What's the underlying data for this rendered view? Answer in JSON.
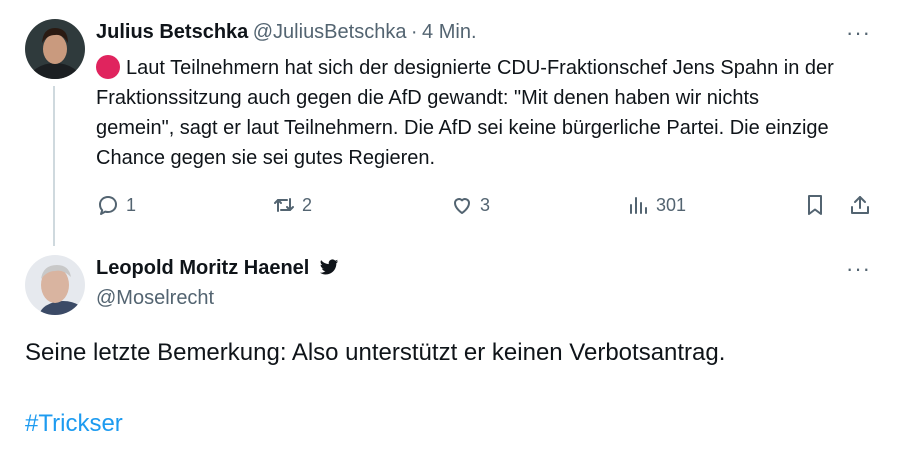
{
  "tweet1": {
    "name": "Julius Betschka",
    "handle": "@JuliusBetschka",
    "separator": "·",
    "time": "4 Min.",
    "text": "Laut Teilnehmern hat sich der designierte CDU-Fraktionschef Jens Spahn in der Fraktionssitzung auch gegen die AfD gewandt: \"Mit denen haben wir nichts gemein\", sagt er laut Teilnehmern. Die AfD sei keine bürgerliche Partei. Die einzige Chance gegen sie sei gutes Regieren.",
    "indicator_icon": "red-circle-emoji",
    "more_label": "···",
    "actions": {
      "reply_count": "1",
      "retweet_count": "2",
      "like_count": "3",
      "views_count": "301"
    }
  },
  "tweet2": {
    "name": "Leopold Moritz Haenel",
    "handle": "@Moselrecht",
    "more_label": "···",
    "verified_icon": "twitter-bird-icon",
    "text": "Seine letzte Bemerkung: Also unterstützt er keinen Verbotsantrag.",
    "hashtag": "#Trickser"
  },
  "colors": {
    "text": "#0f1419",
    "muted": "#536471",
    "link": "#1d9bf0",
    "thread_line": "#cfd9de",
    "indicator": "#e0245e"
  }
}
